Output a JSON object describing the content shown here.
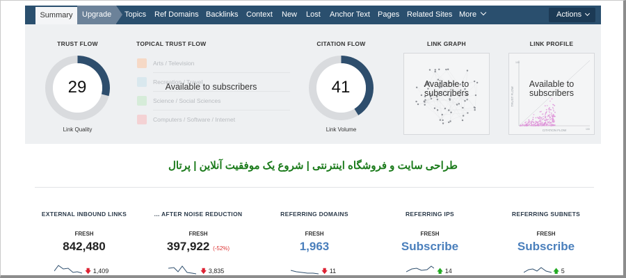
{
  "nav": {
    "tabs": [
      "Summary",
      "Upgrade",
      "Topics",
      "Ref Domains",
      "Backlinks",
      "Context",
      "New",
      "Lost",
      "Anchor Text",
      "Pages",
      "Related Sites",
      "More"
    ],
    "actions_label": "Actions"
  },
  "colors": {
    "nav_bg": "#2a4f6e",
    "donut_fill": "#2e4e6d",
    "link_blue": "#4a7fbc",
    "rtl_green": "#1a7a1a",
    "up": "#22aa22",
    "down": "#dd2233"
  },
  "trust_flow": {
    "title": "TRUST FLOW",
    "value": 29,
    "max": 100,
    "caption": "Link Quality"
  },
  "topical": {
    "title": "TOPICAL TRUST FLOW",
    "items": [
      {
        "label": "Arts / Television",
        "color": "#f6d9c6"
      },
      {
        "label": "Recreation / Travel",
        "color": "#d9e8ee"
      },
      {
        "label": "Science / Social Sciences",
        "color": "#d6ecd9"
      },
      {
        "label": "Computers / Software / Internet",
        "color": "#f4d2d4"
      }
    ],
    "overlay": "Available to subscribers"
  },
  "citation_flow": {
    "title": "CITATION FLOW",
    "value": 41,
    "max": 100,
    "caption": "Link Volume"
  },
  "link_graph": {
    "title": "LINK GRAPH",
    "overlay": "Available to subscribers"
  },
  "link_profile": {
    "title": "LINK PROFILE",
    "overlay": "Available to subscribers",
    "y_axis": "TRUST FLOW",
    "x_axis": "CITATION FLOW",
    "y_max": "100",
    "x_max": "100"
  },
  "site_title": "طراحی سایت و فروشگاه اینترنتی | شروع یک موفقیت آنلاین | پرتال",
  "metrics": [
    {
      "title": "EXTERNAL INBOUND LINKS",
      "fresh": "FRESH",
      "value": "842,480",
      "change_dir": "down",
      "change": "1,409"
    },
    {
      "title": "... AFTER NOISE REDUCTION",
      "fresh": "FRESH",
      "value": "397,922",
      "pct": "(-52%)",
      "change_dir": "down",
      "change": "3,835"
    },
    {
      "title": "REFERRING DOMAINS",
      "fresh": "FRESH",
      "value": "1,963",
      "change_dir": "down",
      "change": "11"
    },
    {
      "title": "REFERRING IPS",
      "fresh": "FRESH",
      "value": "Subscribe",
      "change_dir": "up",
      "change": "14"
    },
    {
      "title": "REFERRING SUBNETS",
      "fresh": "FRESH",
      "value": "Subscribe",
      "change_dir": "up",
      "change": "5"
    }
  ]
}
